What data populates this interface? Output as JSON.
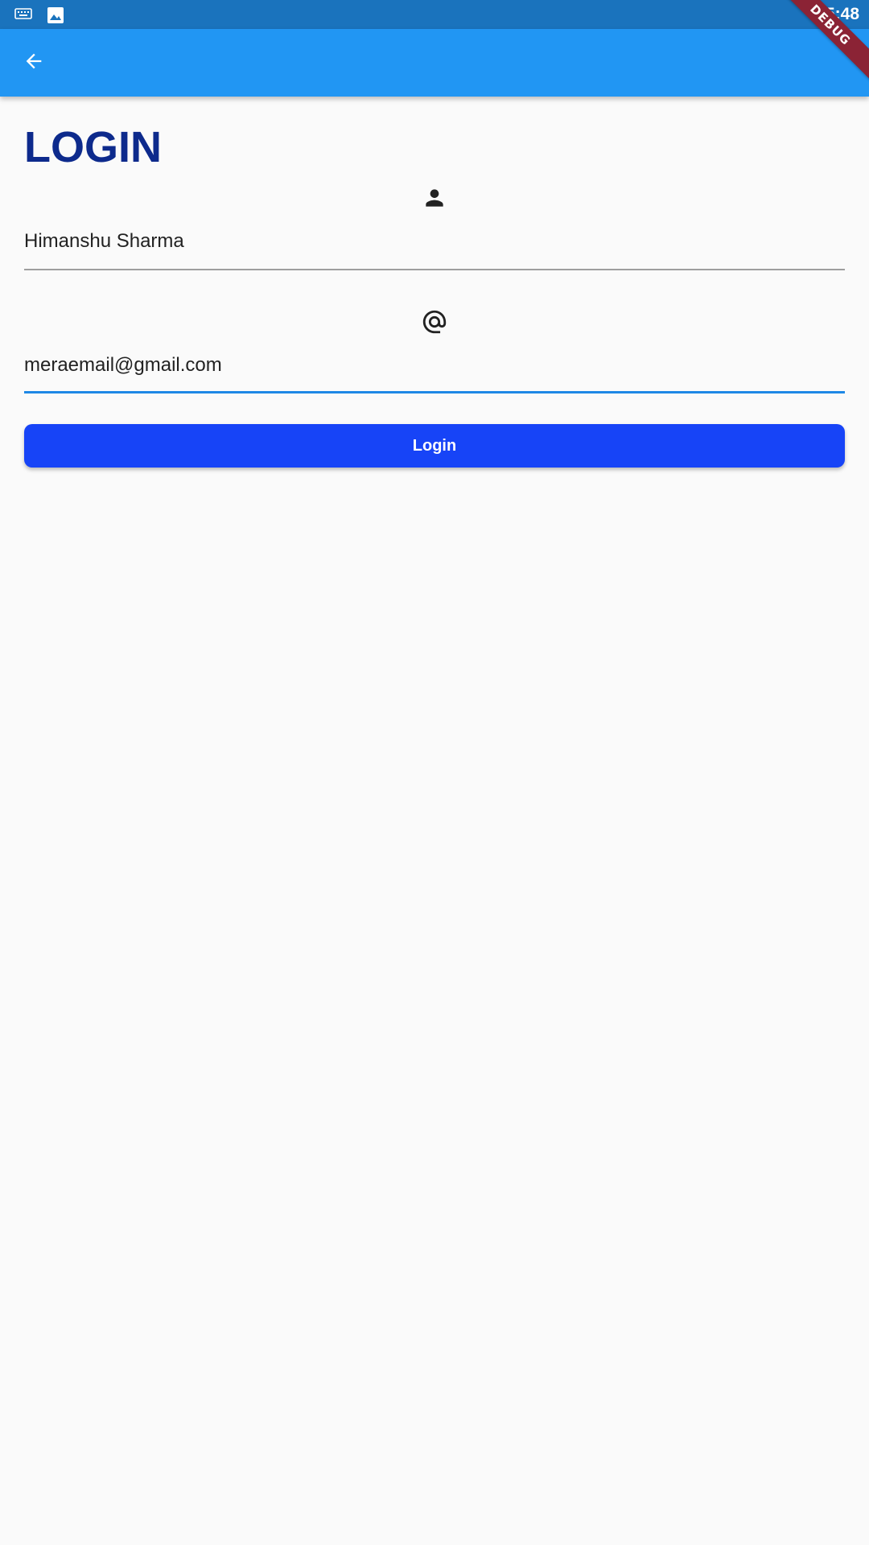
{
  "status_bar": {
    "time": "5:48",
    "icons": [
      "keyboard-icon",
      "image-icon"
    ]
  },
  "app_bar": {
    "back_icon": "arrow-back-icon",
    "color": "#2196f3"
  },
  "debug_banner": {
    "label": "DEBUG"
  },
  "page": {
    "title": "LOGIN",
    "title_color": "#0d2a8c"
  },
  "form": {
    "name_field": {
      "icon": "person-icon",
      "value": "Himanshu Sharma"
    },
    "email_field": {
      "icon": "at-sign-icon",
      "value": "meraemail@gmail.com",
      "focused": true
    },
    "login_button": {
      "label": "Login",
      "color": "#1744f7"
    }
  }
}
